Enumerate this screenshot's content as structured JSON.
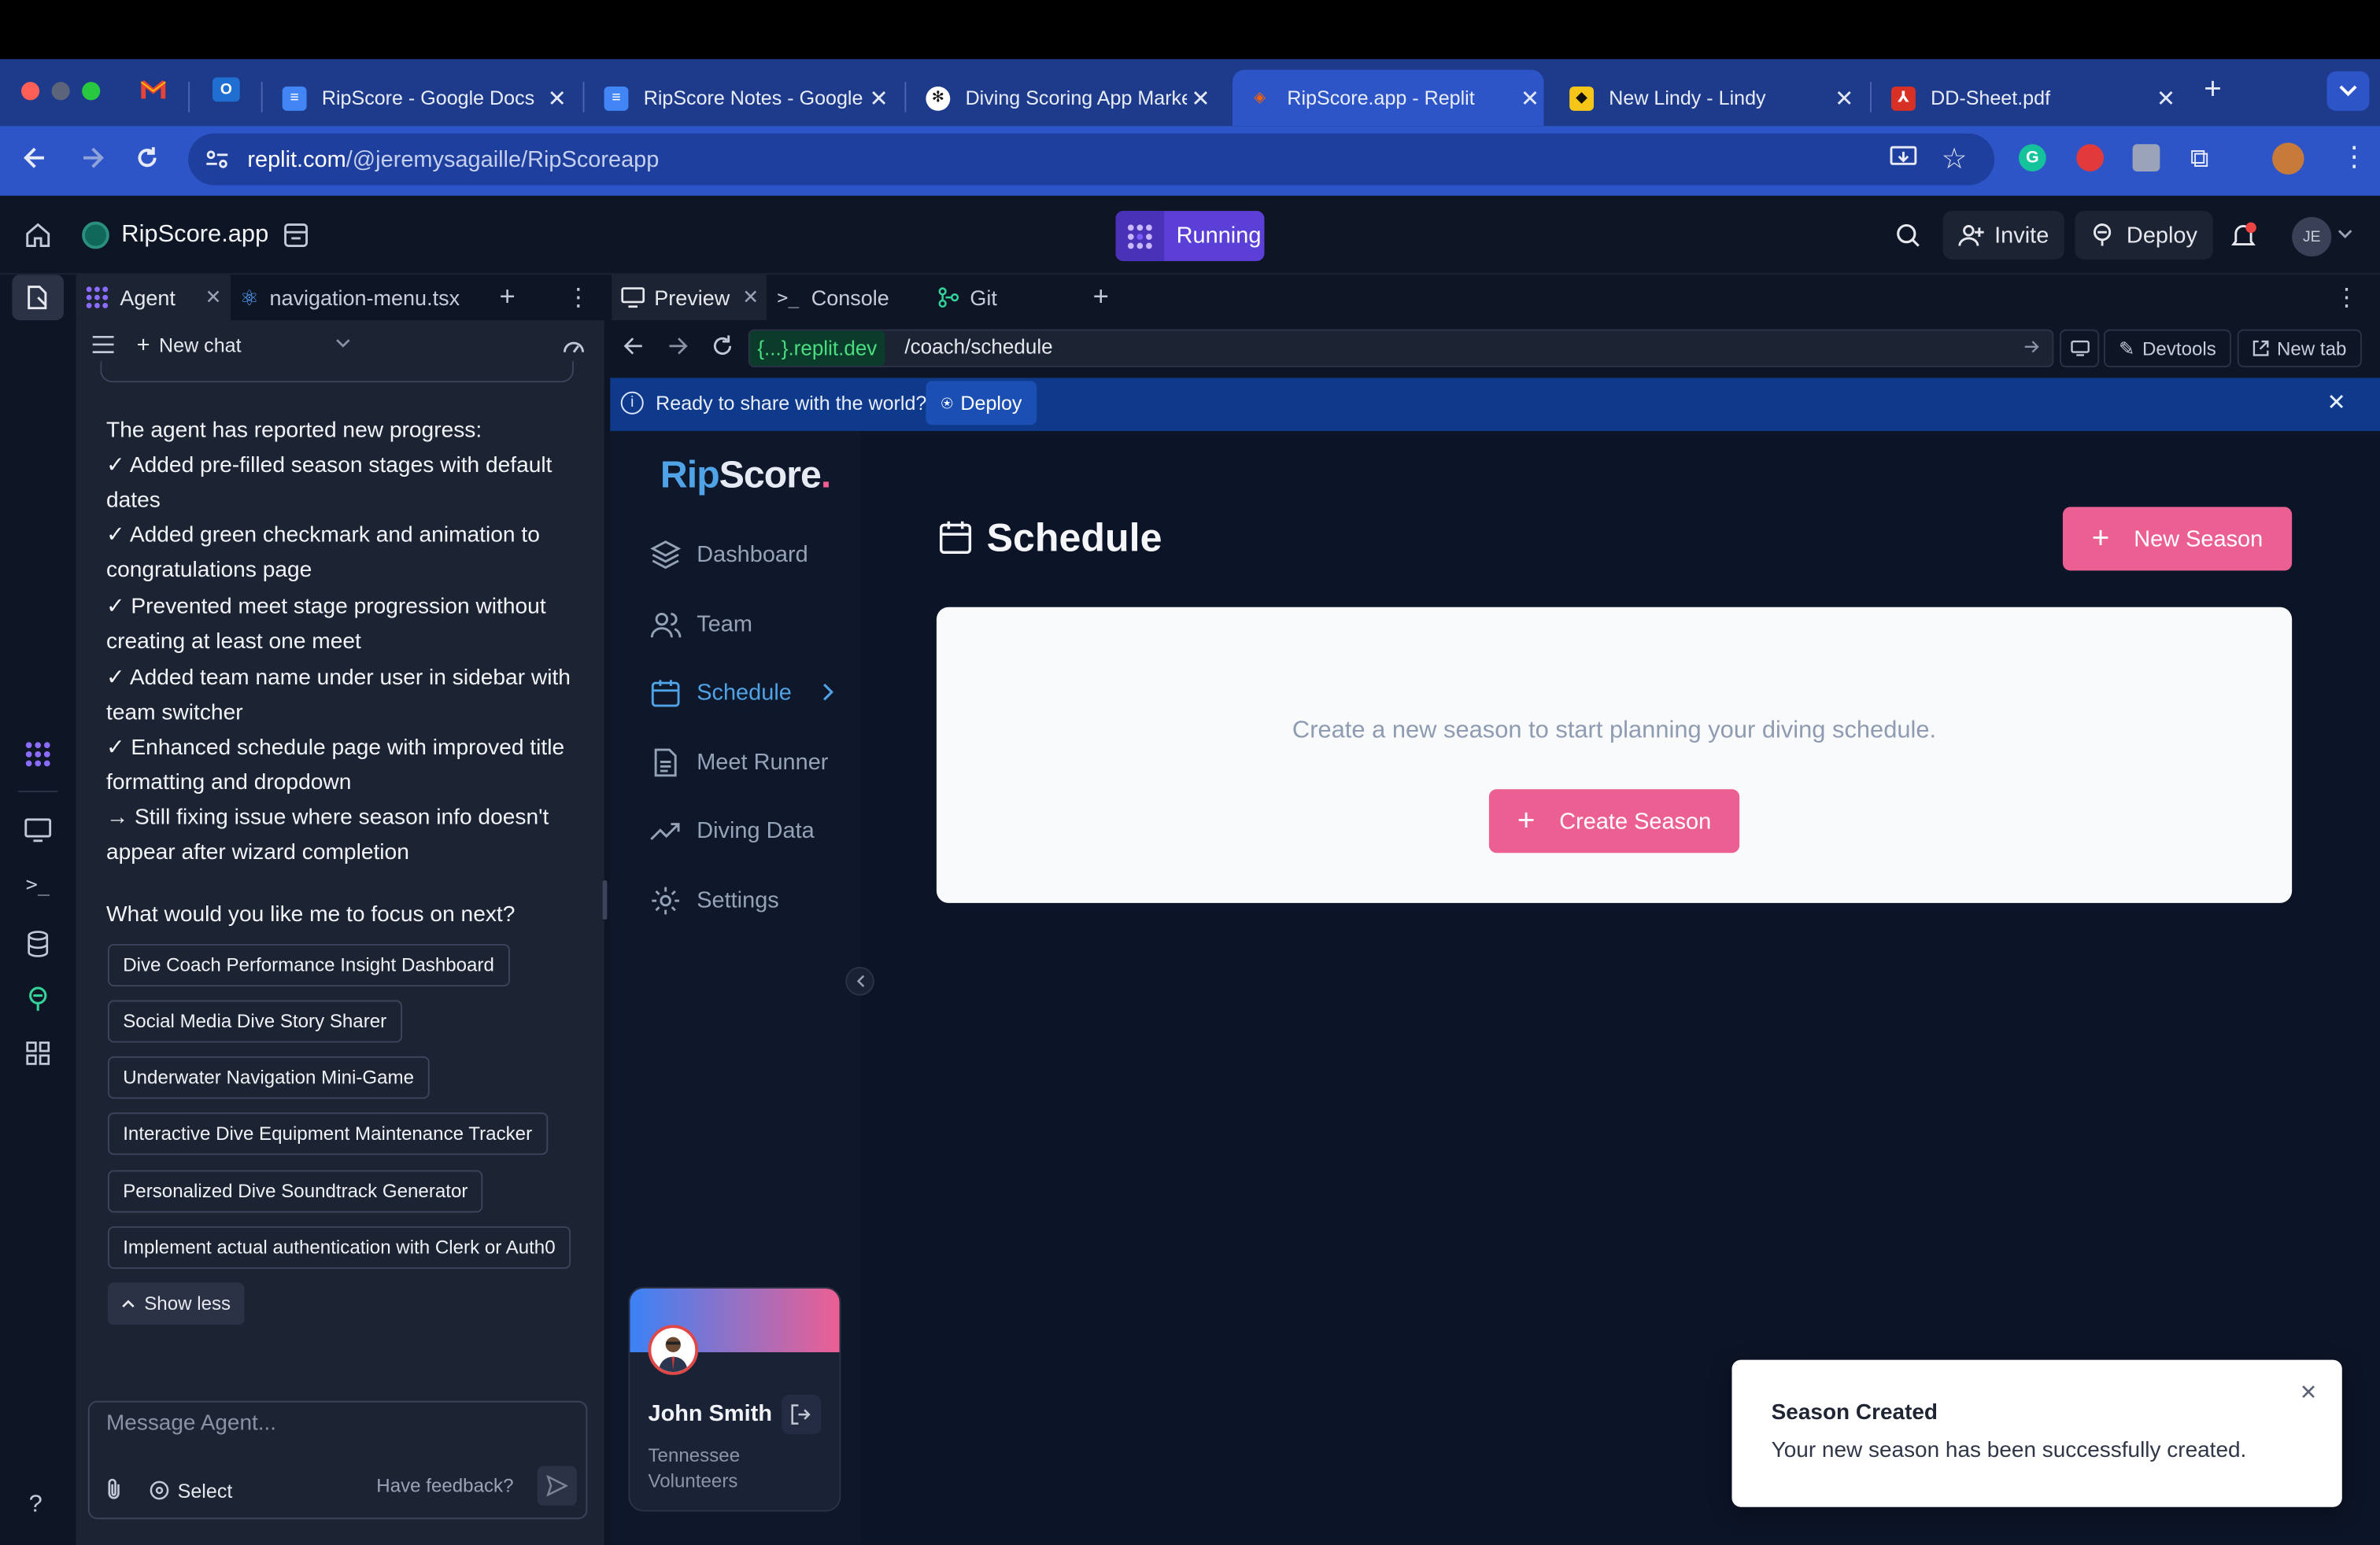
{
  "browser": {
    "tabs": [
      {
        "title": "RipScore - Google Docs"
      },
      {
        "title": "RipScore Notes - Google Docs"
      },
      {
        "title": "Diving Scoring App Market"
      },
      {
        "title": "RipScore.app - Replit"
      },
      {
        "title": "New Lindy - Lindy"
      },
      {
        "title": "DD-Sheet.pdf"
      }
    ],
    "url_host": "replit.com",
    "url_path": "/@jeremysagaille/RipScoreapp"
  },
  "replit": {
    "project_name": "RipScore.app",
    "status": "Running",
    "invite_label": "Invite",
    "deploy_label": "Deploy",
    "avatar_initials": "JE",
    "left_tabs": {
      "agent": "Agent",
      "file": "navigation-menu.tsx"
    },
    "right_tabs": {
      "preview": "Preview",
      "console": "Console",
      "git": "Git"
    },
    "new_chat": "New chat",
    "preview_bar": {
      "domain": "{...}.replit.dev",
      "path": "/coach/schedule",
      "devtools": "Devtools",
      "new_tab": "New tab"
    },
    "share_banner": {
      "text": "Ready to share with the world?",
      "button": "Deploy"
    }
  },
  "agent": {
    "progress_header": "The agent has reported new progress:",
    "progress_items": [
      "✓ Added pre-filled season stages with default dates",
      "✓ Added green checkmark and animation to congratulations page",
      "✓ Prevented meet stage progression without creating at least one meet",
      "✓ Added team name under user in sidebar with team switcher",
      "✓ Enhanced schedule page with improved title formatting and dropdown",
      "→ Still fixing issue where season info doesn't appear after wizard completion"
    ],
    "question": "What would you like me to focus on next?",
    "suggestions": [
      "Dive Coach Performance Insight Dashboard",
      "Social Media Dive Story Sharer",
      "Underwater Navigation Mini-Game",
      "Interactive Dive Equipment Maintenance Tracker",
      "Personalized Dive Soundtrack Generator",
      "Implement actual authentication with Clerk or Auth0"
    ],
    "show_less": "Show less",
    "input_placeholder": "Message Agent...",
    "select_label": "Select",
    "feedback_label": "Have feedback?"
  },
  "app": {
    "logo_a": "Rip",
    "logo_b": "Score",
    "logo_dot": ".",
    "nav": {
      "dashboard": "Dashboard",
      "team": "Team",
      "schedule": "Schedule",
      "meet_runner": "Meet Runner",
      "diving_data": "Diving Data",
      "settings": "Settings"
    },
    "user": {
      "name": "John Smith",
      "team_line1": "Tennessee",
      "team_line2": "Volunteers"
    },
    "page_title": "Schedule",
    "new_season": "New Season",
    "empty_text": "Create a new season to start planning your diving schedule.",
    "create_season": "Create Season",
    "toast": {
      "title": "Season Created",
      "body": "Your new season has been successfully created."
    }
  },
  "colors": {
    "accent_blue": "#2e55c8",
    "pink": "#ec5f93",
    "running": "#5b3fd6"
  }
}
